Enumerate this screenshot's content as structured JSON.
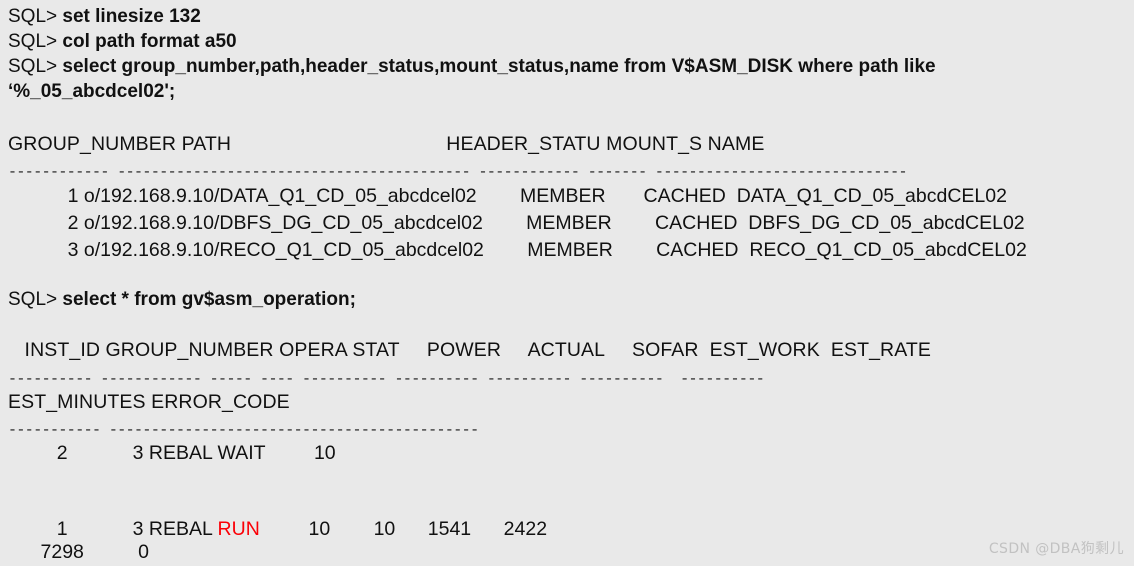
{
  "terminal": {
    "background_color": "#e9e9e9",
    "text_color": "#111111",
    "highlight_color": "#fb0007"
  },
  "lines": {
    "prompt": "SQL> ",
    "cmd1": "set linesize 132",
    "cmd2": "col path format a50",
    "cmd3": "select group_number,path,header_status,mount_status,name from V$ASM_DISK where path like",
    "cmd3_cont": "‘%_05_abcdcel02';",
    "cmd4": "select * from gv$asm_operation;"
  },
  "table1": {
    "header": "GROUP_NUMBER PATH                                       HEADER_STATU MOUNT_S NAME",
    "separator": "------------ ------------------------------------------ ------------ ------- ------------------------------",
    "rows": [
      "           1 o/192.168.9.10/DATA_Q1_CD_05_abcdcel02        MEMBER       CACHED  DATA_Q1_CD_05_abcdCEL02",
      "           2 o/192.168.9.10/DBFS_DG_CD_05_abcdcel02        MEMBER        CACHED  DBFS_DG_CD_05_abcdCEL02",
      "           3 o/192.168.9.10/RECO_Q1_CD_05_abcdcel02        MEMBER        CACHED  RECO_Q1_CD_05_abcdCEL02"
    ]
  },
  "table2": {
    "header_line1": "   INST_ID GROUP_NUMBER OPERA STAT     POWER     ACTUAL     SOFAR  EST_WORK  EST_RATE",
    "separator_line1": "---------- ------------ ----- ---- ---------- ---------- ---------- ----------  ----------",
    "header_line2": "EST_MINUTES ERROR_CODE",
    "separator_line2": "----------- --------------------------------------------",
    "row1": {
      "inst_id": "2",
      "group_number": "3",
      "opera": "REBAL",
      "stat": "WAIT",
      "stat_color": "normal",
      "power": "10",
      "actual": "",
      "sofar": "",
      "est_work": "",
      "est_rate": "",
      "text": "         2            3 REBAL WAIT         10"
    },
    "row2": {
      "inst_id": "1",
      "group_number": "3",
      "opera": "REBAL",
      "stat": "RUN",
      "stat_color": "#fb0007",
      "power": "10",
      "actual": "10",
      "sofar": "1541",
      "est_work": "2422",
      "prefix": "         1            3 REBAL ",
      "suffix": "         10        10      1541      2422"
    },
    "row2_cont": {
      "est_minutes": "7298",
      "error_code": "0",
      "text": "      7298          0"
    }
  },
  "watermark": "CSDN @DBA狗剩儿"
}
